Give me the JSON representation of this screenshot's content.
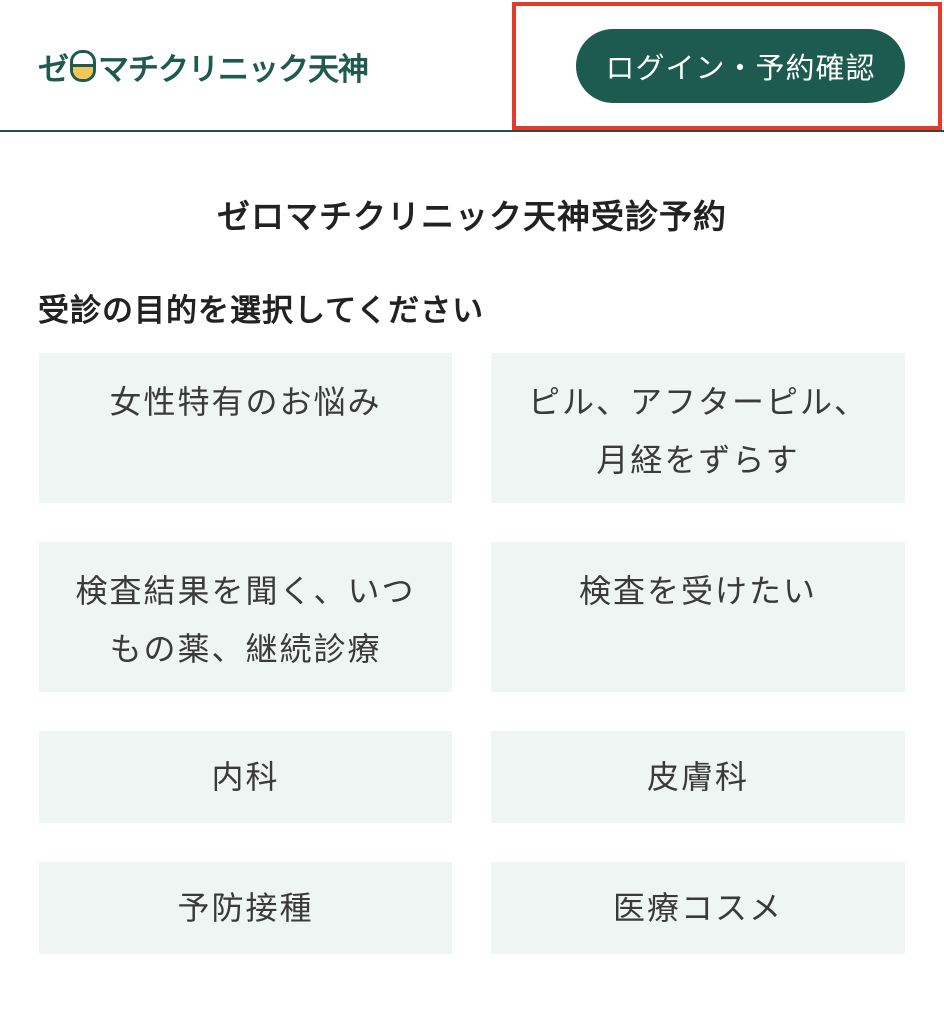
{
  "header": {
    "logo_text_before": "ゼ",
    "logo_text_after": "マチクリニック天神",
    "login_button": "ログイン・予約確認"
  },
  "page_title": "ゼロマチクリニック天神受診予約",
  "section_title": "受診の目的を選択してください",
  "options": [
    {
      "label": "女性特有のお悩み"
    },
    {
      "label": "ピル、アフターピル、月経をずらす"
    },
    {
      "label": "検査結果を聞く、いつもの薬、継続診療"
    },
    {
      "label": "検査を受けたい"
    },
    {
      "label": "内科"
    },
    {
      "label": "皮膚科"
    },
    {
      "label": "予防接種"
    },
    {
      "label": "医療コスメ"
    }
  ],
  "colors": {
    "brand": "#1d5a50",
    "option_bg": "#eef5f3",
    "highlight": "#e53a2a",
    "logo_accent": "#f1c75a"
  }
}
